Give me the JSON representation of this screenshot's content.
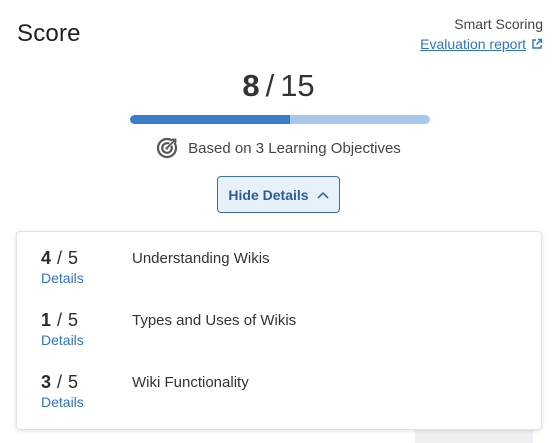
{
  "header": {
    "title": "Score",
    "smart_scoring": "Smart Scoring",
    "report_link": "Evaluation report"
  },
  "score": {
    "obtained": "8",
    "separator": "/",
    "total": "15",
    "progress_fraction": 0.533
  },
  "objectives_text": "Based on 3 Learning Objectives",
  "toggle_label": "Hide Details",
  "objectives": [
    {
      "score": "4",
      "sep": "/",
      "total": "5",
      "details": "Details",
      "label": "Understanding Wikis"
    },
    {
      "score": "1",
      "sep": "/",
      "total": "5",
      "details": "Details",
      "label": "Types and Uses of Wikis"
    },
    {
      "score": "3",
      "sep": "/",
      "total": "5",
      "details": "Details",
      "label": "Wiki Functionality"
    }
  ],
  "colors": {
    "accent": "#2f73c4",
    "bar_fill": "#3a7dc9",
    "bar_track": "#a7c8ee",
    "button_bg": "#e8f0fa"
  },
  "icons": {
    "external_link": "external-link-icon",
    "target": "target-icon",
    "chevron": "chevron-up-icon"
  }
}
